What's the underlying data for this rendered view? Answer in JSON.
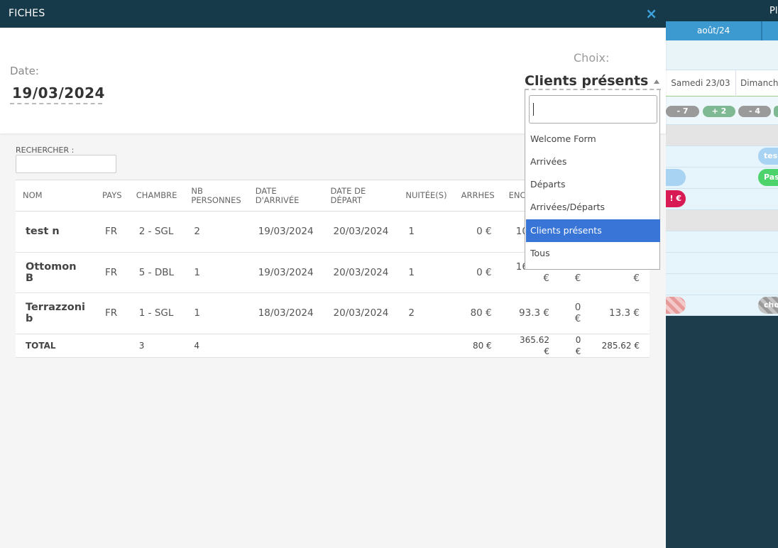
{
  "background": {
    "topbar_label": "Pla",
    "month_label": "août/24",
    "days": [
      "Samedi 23/03",
      "Dimanche"
    ],
    "pills": [
      "- 7",
      "+ 2",
      "- 4"
    ],
    "blobs": [
      "tes",
      "Pas",
      "! €",
      "cho"
    ]
  },
  "modal": {
    "title": "FICHES",
    "close_icon": "×",
    "date_label": "Date:",
    "date_value": "19/03/2024",
    "choix_label": "Choix:",
    "choix_value": "Clients présents",
    "search_label": "RECHERCHER :",
    "search_value": ""
  },
  "dropdown": {
    "search_value": "",
    "options": [
      "Welcome Form",
      "Arrivées",
      "Départs",
      "Arrivées/Départs",
      "Clients présents",
      "Tous"
    ],
    "selected": "Clients présents"
  },
  "table": {
    "headers": [
      "NOM",
      "PAYS",
      "CHAMBRE",
      "NB PERSONNES",
      "DATE D'ARRIVÉE",
      "DATE DE DÉPART",
      "NUITÉE(S)",
      "ARRHES",
      "ENCOURS",
      "",
      ""
    ],
    "rows": [
      {
        "nom": "test n",
        "pays": "FR",
        "chambre": "2 - SGL",
        "nb": "2",
        "arrivee": "19/03/2024",
        "depart": "20/03/2024",
        "nuitees": "1",
        "arrhes": "0 €",
        "encours": "102.67",
        "c10": "",
        "c11": ""
      },
      {
        "nom": "Ottomon B",
        "pays": "FR",
        "chambre": "5 - DBL",
        "nb": "1",
        "arrivee": "19/03/2024",
        "depart": "20/03/2024",
        "nuitees": "1",
        "arrhes": "0 €",
        "encours": "169.65 €",
        "c10": "0 €",
        "c11": "169.65 €"
      },
      {
        "nom": "Terrazzoni b",
        "pays": "FR",
        "chambre": "1 - SGL",
        "nb": "1",
        "arrivee": "18/03/2024",
        "depart": "20/03/2024",
        "nuitees": "2",
        "arrhes": "80 €",
        "encours": "93.3 €",
        "c10": "0 €",
        "c11": "13.3 €"
      }
    ],
    "total": {
      "label": "TOTAL",
      "chambre": "3",
      "nb": "4",
      "arrhes": "80 €",
      "encours": "365.62 €",
      "c10": "0 €",
      "c11": "285.62 €"
    }
  },
  "colors": {
    "header_bg": "#163a4a",
    "accent": "#3da3dd",
    "selected_option": "#3875d7"
  }
}
